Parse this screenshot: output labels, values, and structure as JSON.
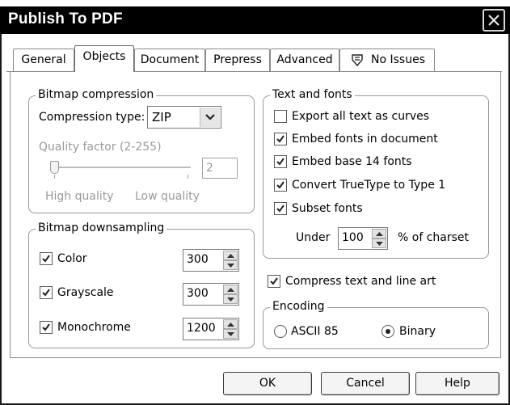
{
  "window": {
    "title": "Publish To PDF"
  },
  "tabs": [
    {
      "label": "General"
    },
    {
      "label": "Objects"
    },
    {
      "label": "Document"
    },
    {
      "label": "Prepress"
    },
    {
      "label": "Advanced"
    },
    {
      "label": "No Issues",
      "icon": "issues-icon"
    }
  ],
  "active_tab": "Objects",
  "bitmap_compression": {
    "legend": "Bitmap compression",
    "compression_type_label": "Compression type:",
    "compression_type_value": "ZIP",
    "quality_label": "Quality factor (2-255)",
    "quality_value": "2",
    "high_quality_label": "High quality",
    "low_quality_label": "Low quality"
  },
  "bitmap_downsampling": {
    "legend": "Bitmap downsampling",
    "rows": [
      {
        "label": "Color",
        "checked": true,
        "value": "300"
      },
      {
        "label": "Grayscale",
        "checked": true,
        "value": "300"
      },
      {
        "label": "Monochrome",
        "checked": true,
        "value": "1200"
      }
    ]
  },
  "text_fonts": {
    "legend": "Text and fonts",
    "options": [
      {
        "label": "Export all text as curves",
        "checked": false
      },
      {
        "label": "Embed fonts in document",
        "checked": true
      },
      {
        "label": "Embed base 14 fonts",
        "checked": true
      },
      {
        "label": "Convert TrueType to Type 1",
        "checked": true
      },
      {
        "label": "Subset fonts",
        "checked": true
      }
    ],
    "under_label": "Under",
    "under_value": "100",
    "charset_label": "% of charset"
  },
  "compress": {
    "label": "Compress text and line art",
    "checked": true
  },
  "encoding": {
    "legend": "Encoding",
    "options": [
      {
        "label": "ASCII 85",
        "selected": false
      },
      {
        "label": "Binary",
        "selected": true
      }
    ]
  },
  "buttons": {
    "ok": "OK",
    "cancel": "Cancel",
    "help": "Help"
  }
}
